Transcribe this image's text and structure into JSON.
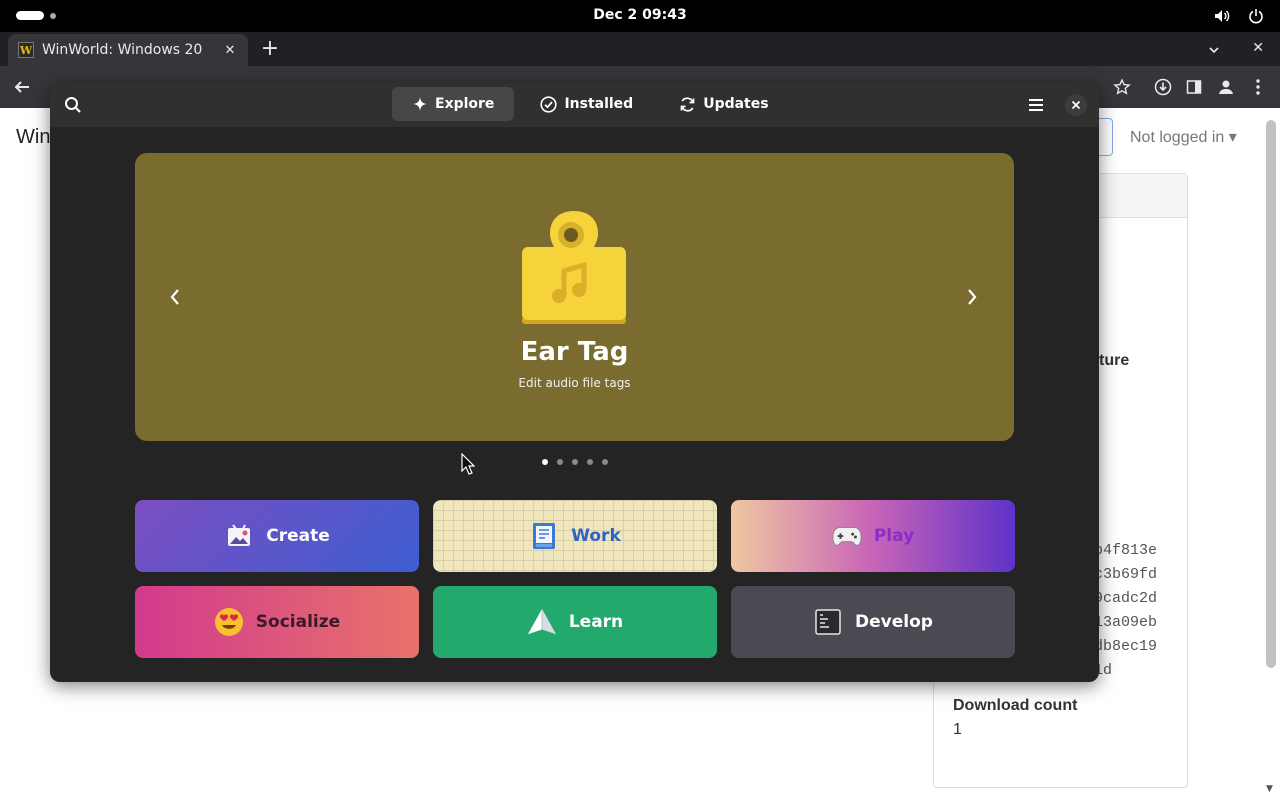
{
  "topbar": {
    "datetime": "Dec 2  09:43"
  },
  "browser": {
    "tab_title": "WinWorld: Windows 20",
    "favicon_letter": "W",
    "new_tab_symbol": "+"
  },
  "webpage": {
    "site_title": "Win",
    "login_text": "Not logged in",
    "partial_heading": "ture",
    "hash_lines": [
      "b4f813e",
      "c3b69fd",
      "9cadc2d",
      "13a09eb",
      "db8ec19",
      "1d"
    ],
    "download_count_label": "Download count",
    "download_count_value": "1"
  },
  "software": {
    "tabs": [
      {
        "label": "Explore",
        "icon": "sparkle-icon",
        "active": true
      },
      {
        "label": "Installed",
        "icon": "checkmark-icon",
        "active": false
      },
      {
        "label": "Updates",
        "icon": "refresh-icon",
        "active": false
      }
    ],
    "featured": {
      "app_name": "Ear Tag",
      "summary": "Edit audio file tags",
      "background": "#7a6c2f",
      "page_index": 1,
      "page_count": 5
    },
    "categories": [
      {
        "label": "Create",
        "icon": "create-icon"
      },
      {
        "label": "Work",
        "icon": "work-icon"
      },
      {
        "label": "Play",
        "icon": "gamepad-icon"
      },
      {
        "label": "Socialize",
        "icon": "heart-eyes-emoji-icon"
      },
      {
        "label": "Learn",
        "icon": "paper-plane-icon"
      },
      {
        "label": "Develop",
        "icon": "terminal-icon"
      }
    ]
  }
}
